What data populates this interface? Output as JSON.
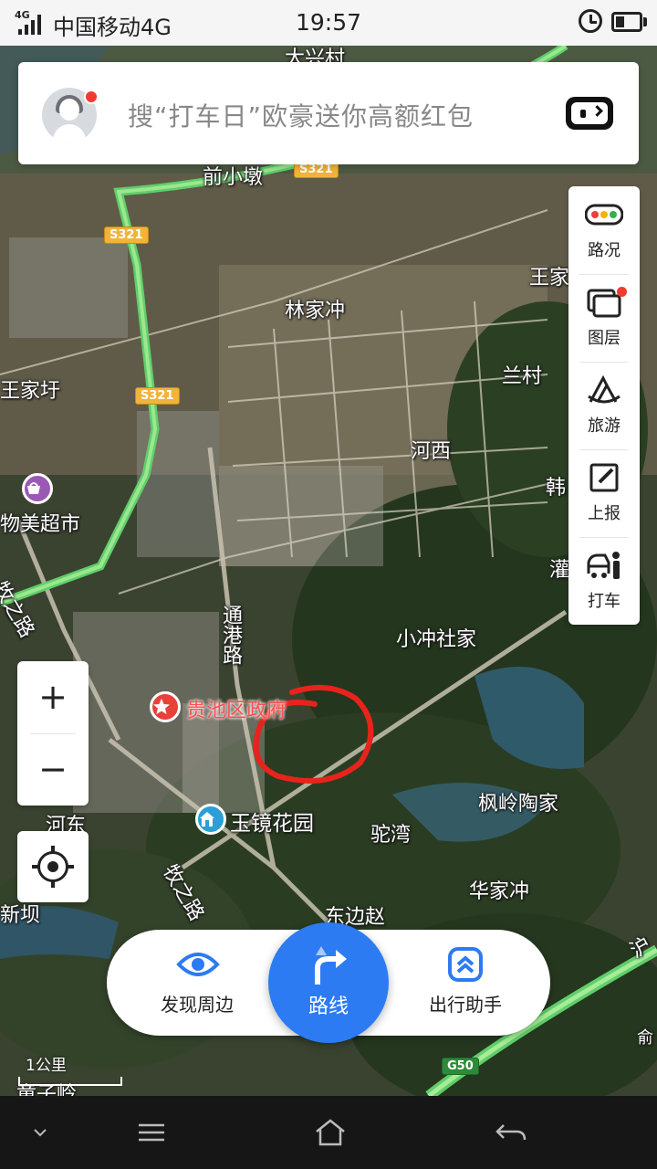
{
  "status_bar": {
    "network_tag": "4G",
    "carrier": "中国移动4G",
    "time": "19:57"
  },
  "search": {
    "placeholder": "搜“打车日”欧豪送你高额红包"
  },
  "tools": [
    {
      "label": "路况",
      "icon": "traffic-light-icon"
    },
    {
      "label": "图层",
      "icon": "layers-icon"
    },
    {
      "label": "旅游",
      "icon": "travel-icon"
    },
    {
      "label": "上报",
      "icon": "report-edit-icon"
    },
    {
      "label": "打车",
      "icon": "taxi-icon"
    }
  ],
  "zoom": {
    "in_label": "+",
    "out_label": "−"
  },
  "actions": {
    "discover_label": "发现周边",
    "route_label": "路线",
    "assistant_label": "出行助手"
  },
  "scale": {
    "label": "1公里"
  },
  "map": {
    "places": {
      "daxingcun": "大兴村",
      "qianxiaodun": "前小墩",
      "linjiachong": "林家冲",
      "wangjia_right": "王家",
      "wangjiawei": "王家圩",
      "lancun": "兰村",
      "hexi": "河西",
      "wumei": "物美超市",
      "muzhilu_top": "牧之路",
      "tonggang": "通港路",
      "xiaochongshe": "小冲社家",
      "government": "贵池区政府",
      "fenglingtao": "枫岭陶家",
      "yujing": "玉镜花园",
      "hedong": "河东",
      "tuowan": "驼湾",
      "huajiachong": "华家冲",
      "xinba": "新坝",
      "dongbianzhao": "东边赵",
      "muzhilu_bottom": "牧之路",
      "tongzi": "童子岭",
      "han": "韩",
      "guan": "灌",
      "yu": "俞",
      "hu": "沪"
    },
    "roads": {
      "s321_a": "S321",
      "s321_b": "S321",
      "s321_c": "S321",
      "g50": "G50"
    }
  },
  "colors": {
    "accent": "#2c7bf3",
    "highway": "#7cd36f",
    "annotation": "#e8231c",
    "notification": "#f23b30"
  }
}
